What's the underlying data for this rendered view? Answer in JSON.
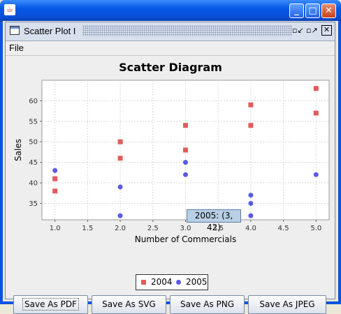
{
  "window": {
    "minimize_glyph": "_",
    "maximize_glyph": "□",
    "close_glyph": "✕",
    "app_icon": "java-icon"
  },
  "internal_frame": {
    "title": "Scatter Plot I",
    "ctrl_iconify": "▫↙",
    "ctrl_maximize": "▫↗",
    "ctrl_close": "✕"
  },
  "menubar": {
    "file": "File"
  },
  "chart_data": {
    "type": "scatter",
    "title": "Scatter Diagram",
    "xlabel": "Number of Commercials",
    "ylabel": "Sales",
    "xlim": [
      0.8,
      5.2
    ],
    "ylim": [
      31,
      65
    ],
    "xticks": [
      "1.0",
      "1.5",
      "2.0",
      "2.5",
      "3.0",
      "3.5",
      "4.0",
      "4.5",
      "5.0"
    ],
    "yticks": [
      "35",
      "40",
      "45",
      "50",
      "55",
      "60"
    ],
    "grid": true,
    "legend_position": "bottom",
    "series": [
      {
        "name": "2004",
        "marker": "square",
        "color": "#E35B5B",
        "points": [
          [
            1,
            41
          ],
          [
            1,
            38
          ],
          [
            2,
            50
          ],
          [
            2,
            46
          ],
          [
            3,
            54
          ],
          [
            3,
            48
          ],
          [
            4,
            59
          ],
          [
            4,
            54
          ],
          [
            5,
            63
          ],
          [
            5,
            57
          ]
        ]
      },
      {
        "name": "2005",
        "marker": "circle",
        "color": "#5A5AE6",
        "points": [
          [
            1,
            43
          ],
          [
            2,
            39
          ],
          [
            2,
            32
          ],
          [
            3,
            45
          ],
          [
            3,
            42
          ],
          [
            4,
            37
          ],
          [
            4,
            35
          ],
          [
            4,
            32
          ],
          [
            5,
            42
          ]
        ]
      }
    ]
  },
  "tooltip": {
    "text": "2005: (3, 42)"
  },
  "buttons": {
    "pdf": "Save As PDF",
    "svg": "Save As SVG",
    "png": "Save As PNG",
    "jpeg": "Save As JPEG"
  }
}
